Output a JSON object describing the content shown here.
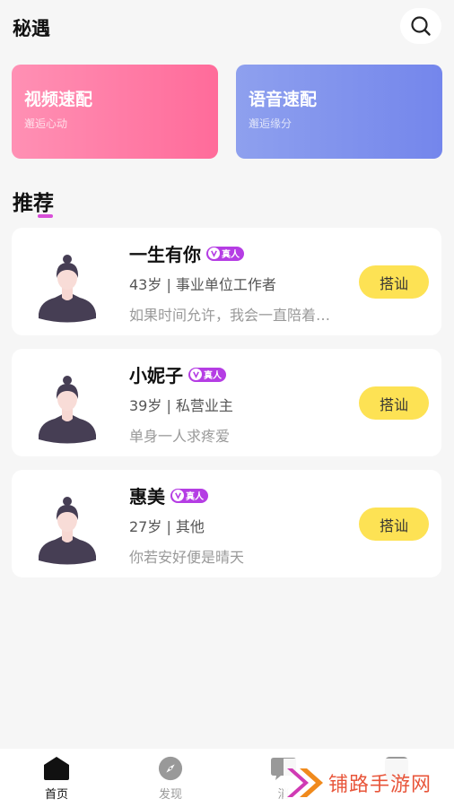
{
  "header": {
    "title": "秘遇"
  },
  "match": [
    {
      "title": "视频速配",
      "subtitle": "邂逅心动"
    },
    {
      "title": "语音速配",
      "subtitle": "邂逅缘分"
    }
  ],
  "section": {
    "title": "推荐"
  },
  "users": [
    {
      "name": "一生有你",
      "badge": "真人",
      "info": "43岁 | 事业单位工作者",
      "bio": "如果时间允许，我会一直陪着…",
      "action": "搭讪"
    },
    {
      "name": "小妮子",
      "badge": "真人",
      "info": "39岁 | 私营业主",
      "bio": "单身一人求疼爱",
      "action": "搭讪"
    },
    {
      "name": "惠美",
      "badge": "真人",
      "info": "27岁 | 其他",
      "bio": "你若安好便是晴天",
      "action": "搭讪"
    }
  ],
  "tabbar": {
    "items": [
      {
        "label": "首页",
        "active": true
      },
      {
        "label": "发现",
        "active": false
      },
      {
        "label": "消",
        "active": false
      },
      {
        "label": "",
        "active": false
      }
    ]
  },
  "watermark": {
    "text": "铺路手游网"
  },
  "colors": {
    "video_card": "#ff6b9a",
    "voice_card": "#7486ec",
    "accent_purple": "#b53de4",
    "chat_button": "#fde254",
    "tab_active": "#111111",
    "tab_inactive": "#999999"
  }
}
